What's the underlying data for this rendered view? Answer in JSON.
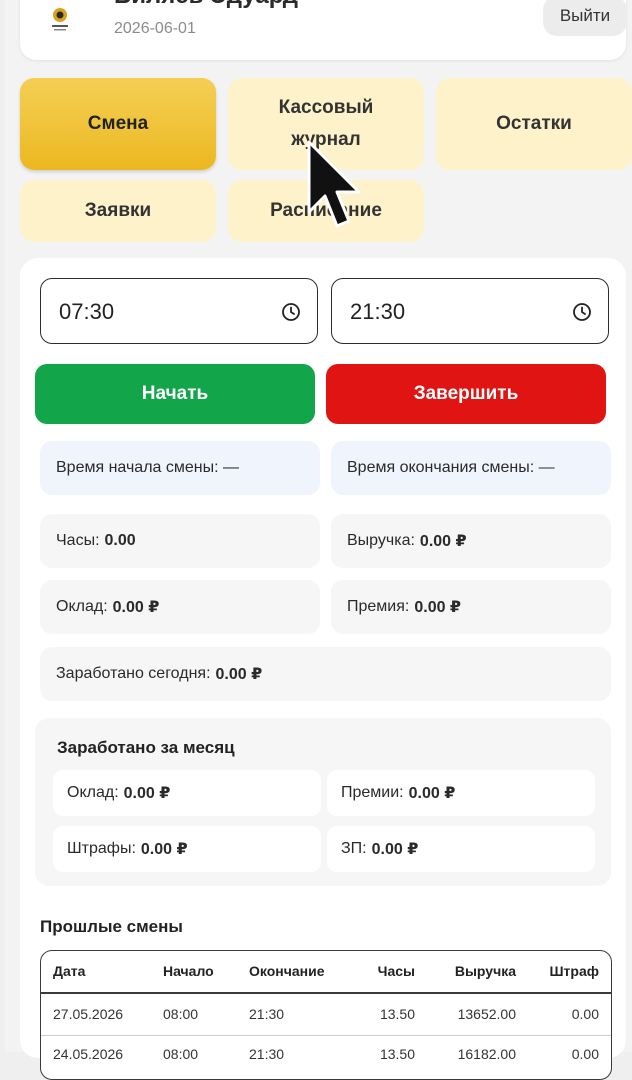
{
  "header": {
    "user_name": "Биляев Эдуард",
    "date": "2026-06-01",
    "logout_label": "Выйти",
    "logo_icon": "company-logo"
  },
  "nav": {
    "tiles": [
      {
        "label": "Смена",
        "active": true
      },
      {
        "label": "Кассовый журнал",
        "active": false
      },
      {
        "label": "Остатки",
        "active": false
      },
      {
        "label": "Заявки",
        "active": false
      },
      {
        "label": "Расписание",
        "active": false
      }
    ]
  },
  "shift": {
    "start_time": "07:30",
    "end_time": "21:30",
    "start_button": "Начать",
    "end_button": "Завершить",
    "start_label": "Время начала смены:",
    "start_value": "—",
    "end_label": "Время окончания смены:",
    "end_value": "—",
    "hours_label": "Часы:",
    "hours_value": "0.00",
    "revenue_label": "Выручка:",
    "revenue_value": "0.00 ₽",
    "salary_label": "Оклад:",
    "salary_value": "0.00 ₽",
    "bonus_label": "Премия:",
    "bonus_value": "0.00 ₽",
    "earned_today_label": "Заработано сегодня:",
    "earned_today_value": "0.00 ₽"
  },
  "month": {
    "title": "Заработано за месяц",
    "salary_label": "Оклад:",
    "salary_value": "0.00 ₽",
    "bonuses_label": "Премии:",
    "bonuses_value": "0.00 ₽",
    "fines_label": "Штрафы:",
    "fines_value": "0.00 ₽",
    "pay_label": "ЗП:",
    "pay_value": "0.00 ₽"
  },
  "past_shifts": {
    "title": "Прошлые смены",
    "columns": [
      "Дата",
      "Начало",
      "Окончание",
      "Часы",
      "Выручка",
      "Штраф"
    ],
    "rows": [
      [
        "27.05.2026",
        "08:00",
        "21:30",
        "13.50",
        "13652.00",
        "0.00"
      ],
      [
        "24.05.2026",
        "08:00",
        "21:30",
        "13.50",
        "16182.00",
        "0.00"
      ]
    ]
  },
  "colors": {
    "accent_yellow": "#ecb820",
    "tile_bg": "#fdf2c9",
    "start_green": "#12a54a",
    "end_red": "#df1413"
  }
}
